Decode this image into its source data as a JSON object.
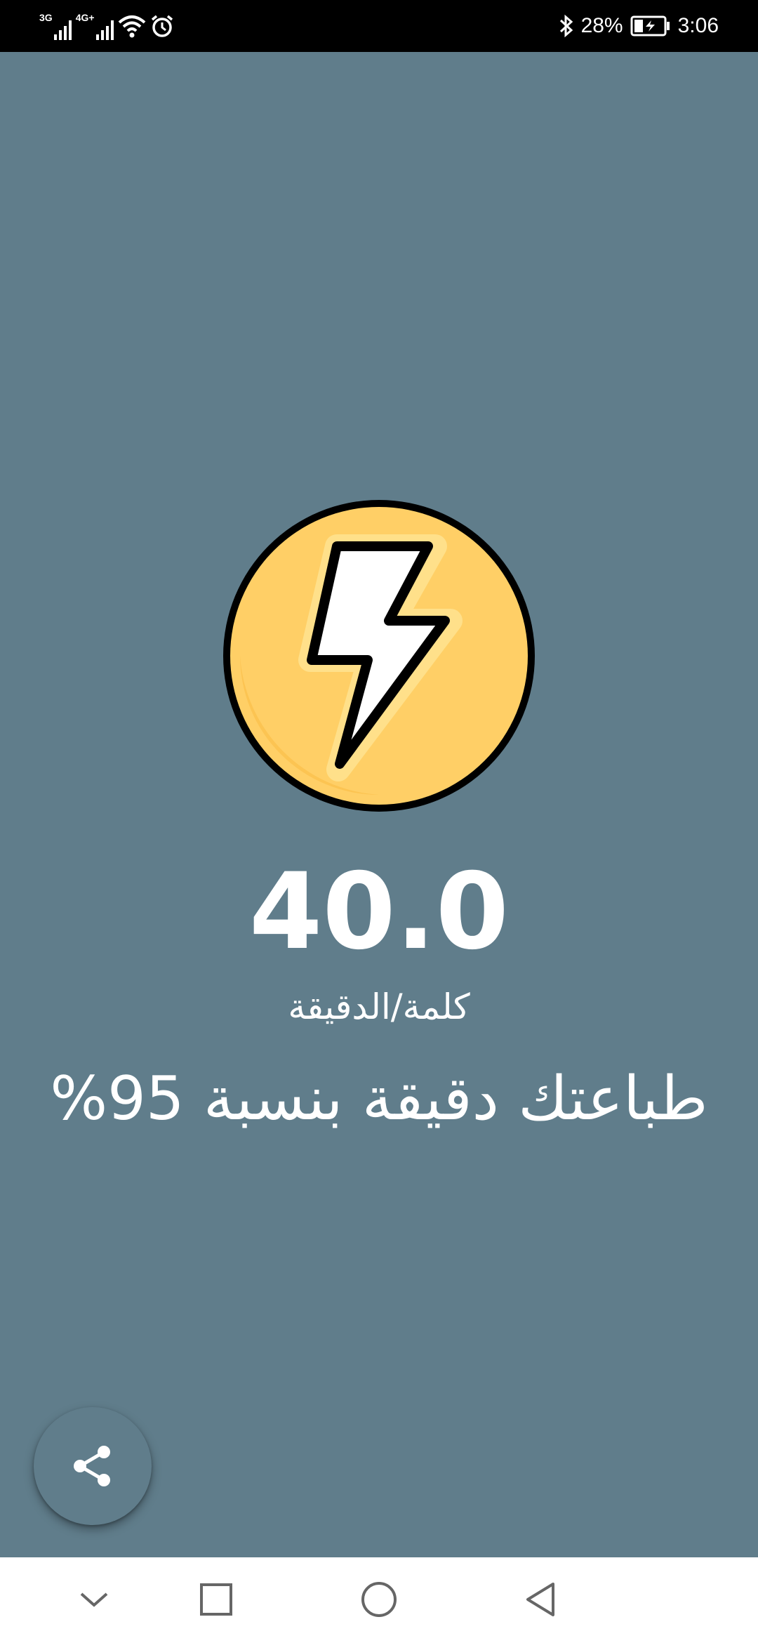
{
  "status_bar": {
    "network_1": "3G",
    "network_2": "4G+",
    "battery_percent": "28%",
    "time": "3:06",
    "icons": [
      "signal-icon",
      "signal-icon",
      "wifi-icon",
      "alarm-icon",
      "bluetooth-icon",
      "battery-charging-icon"
    ]
  },
  "result": {
    "speed_value": "40.0",
    "speed_unit": "كلمة/الدقيقة",
    "accuracy_text": "طباعتك دقيقة بنسبة 95%"
  },
  "badge": {
    "icon": "lightning-bolt-icon",
    "fill_color": "#ffcf66",
    "outline_color": "#000000"
  },
  "share_button": {
    "icon": "share-icon"
  },
  "nav_bar": {
    "buttons": [
      "chevron-down-icon",
      "square-recents-icon",
      "circle-home-icon",
      "triangle-back-icon"
    ]
  },
  "colors": {
    "background": "#607d8b",
    "status_bar": "#000000",
    "nav_bar": "#ffffff"
  }
}
